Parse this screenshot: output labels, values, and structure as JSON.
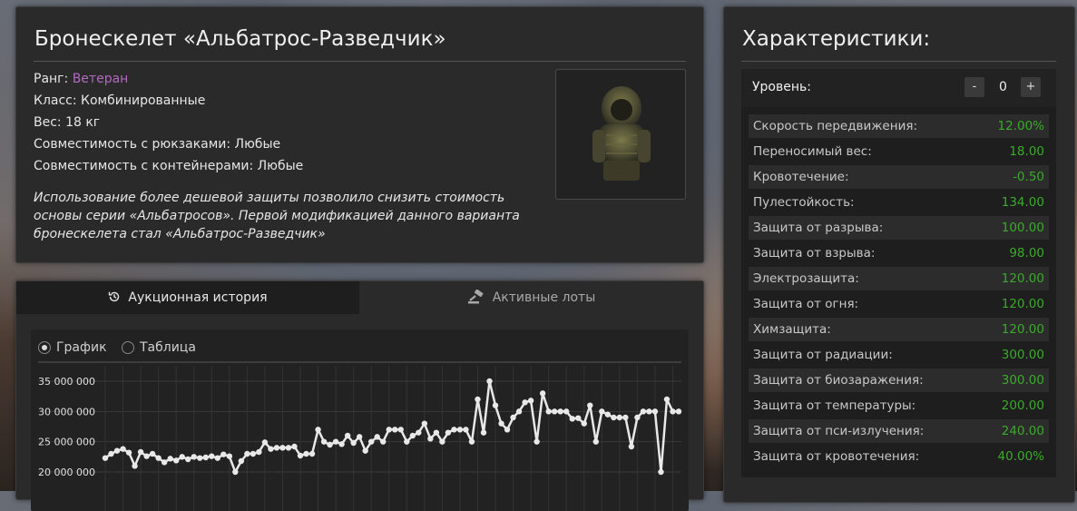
{
  "item": {
    "title": "Бронескелет «Альбатрос-Разведчик»",
    "rank_label": "Ранг: ",
    "rank_value": "Ветеран",
    "class": "Класс: Комбинированные",
    "weight": "Вес: 18 кг",
    "backpack_compat": "Совместимость с рюкзаками: Любые",
    "container_compat": "Совместимость с контейнерами: Любые",
    "description": "Использование более дешевой защиты позволило снизить стоимость основы серии «Альбатросов». Первой модификацией данного варианта бронескелета стал «Альбатрос-Разведчик»",
    "rank_color": "#b26ac0",
    "image_icon": "exoskeleton-armor-icon"
  },
  "auction": {
    "tabs": [
      {
        "label": "Аукционная история",
        "icon": "history-icon",
        "active": true
      },
      {
        "label": "Активные лоты",
        "icon": "gavel-icon",
        "active": false
      }
    ],
    "view_options": [
      {
        "label": "График",
        "selected": true
      },
      {
        "label": "Таблица",
        "selected": false
      }
    ]
  },
  "chart_data": {
    "type": "line",
    "ylim": [
      17500000,
      37000000
    ],
    "yticks": [
      "35 000 000",
      "30 000 000",
      "25 000 000",
      "20 000 000"
    ],
    "ytick_values": [
      35000000,
      30000000,
      25000000,
      20000000
    ],
    "grid": true,
    "series": [
      {
        "values": [
          22300000,
          23000000,
          23500000,
          23800000,
          23200000,
          21000000,
          23300000,
          22600000,
          23000000,
          22300000,
          21600000,
          22200000,
          21900000,
          22500000,
          22100000,
          22500000,
          22300000,
          22400000,
          22600000,
          22300000,
          22900000,
          22600000,
          20000000,
          21800000,
          23000000,
          23000000,
          23300000,
          24900000,
          23800000,
          24000000,
          24000000,
          24000000,
          24200000,
          22700000,
          23000000,
          23000000,
          27000000,
          25000000,
          24500000,
          25000000,
          24600000,
          26000000,
          24800000,
          25800000,
          23500000,
          25000000,
          25800000,
          25000000,
          27000000,
          27000000,
          27000000,
          25000000,
          26000000,
          26500000,
          28000000,
          25500000,
          26500000,
          25000000,
          26500000,
          27000000,
          27000000,
          27000000,
          25000000,
          32000000,
          26500000,
          35000000,
          31000000,
          28000000,
          27000000,
          29000000,
          30000000,
          31500000,
          31800000,
          25000000,
          33000000,
          30000000,
          30000000,
          30000000,
          30000000,
          28800000,
          28900000,
          28000000,
          31000000,
          25000000,
          30000000,
          29500000,
          29000000,
          29000000,
          29000000,
          24200000,
          29000000,
          30000000,
          30000000,
          30000000,
          20000000,
          32000000,
          30000000,
          30000000
        ]
      }
    ],
    "line_color": "#e8e8e8"
  },
  "stats": {
    "title": "Характеристики:",
    "level_label": "Уровень:",
    "level_value": "0",
    "minus_label": "-",
    "plus_label": "+",
    "value_color": "#3aaa2a",
    "rows": [
      {
        "name": "Скорость передвижения:",
        "value": "12.00%"
      },
      {
        "name": "Переносимый вес:",
        "value": "18.00"
      },
      {
        "name": "Кровотечение:",
        "value": "-0.50"
      },
      {
        "name": "Пулестойкость:",
        "value": "134.00"
      },
      {
        "name": "Защита от разрыва:",
        "value": "100.00"
      },
      {
        "name": "Защита от взрыва:",
        "value": "98.00"
      },
      {
        "name": "Электрозащита:",
        "value": "120.00"
      },
      {
        "name": "Защита от огня:",
        "value": "120.00"
      },
      {
        "name": "Химзащита:",
        "value": "120.00"
      },
      {
        "name": "Защита от радиации:",
        "value": "300.00"
      },
      {
        "name": "Защита от биозаражения:",
        "value": "300.00"
      },
      {
        "name": "Защита от температуры:",
        "value": "200.00"
      },
      {
        "name": "Защита от пси-излучения:",
        "value": "240.00"
      },
      {
        "name": "Защита от кровотечения:",
        "value": "40.00%"
      }
    ]
  }
}
